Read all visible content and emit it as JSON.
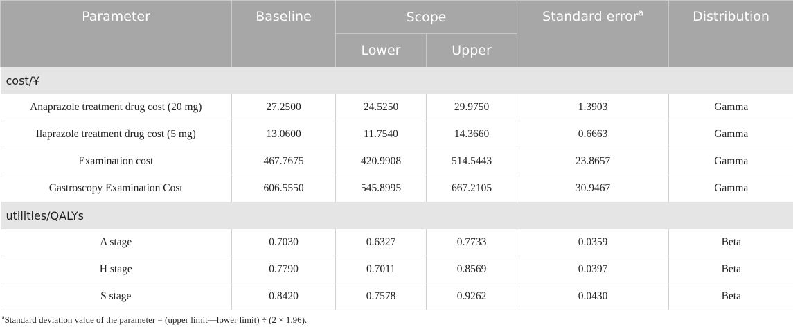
{
  "header": {
    "parameter": "Parameter",
    "baseline": "Baseline",
    "scope": "Scope",
    "lower": "Lower",
    "upper": "Upper",
    "standard_error": "Standard error",
    "standard_error_note": "a",
    "distribution": "Distribution"
  },
  "sections": [
    {
      "title": "cost/¥",
      "rows": [
        [
          "Anaprazole treatment drug cost (20 mg)",
          "27.2500",
          "24.5250",
          "29.9750",
          "1.3903",
          "Gamma"
        ],
        [
          "Ilaprazole treatment drug cost (5 mg)",
          "13.0600",
          "11.7540",
          "14.3660",
          "0.6663",
          "Gamma"
        ],
        [
          "Examination cost",
          "467.7675",
          "420.9908",
          "514.5443",
          "23.8657",
          "Gamma"
        ],
        [
          "Gastroscopy Examination Cost",
          "606.5550",
          "545.8995",
          "667.2105",
          "30.9467",
          "Gamma"
        ]
      ]
    },
    {
      "title": "utilities/QALYs",
      "rows": [
        [
          "A stage",
          "0.7030",
          "0.6327",
          "0.7733",
          "0.0359",
          "Beta"
        ],
        [
          "H stage",
          "0.7790",
          "0.7011",
          "0.8569",
          "0.0397",
          "Beta"
        ],
        [
          "S stage",
          "0.8420",
          "0.7578",
          "0.9262",
          "0.0430",
          "Beta"
        ]
      ]
    }
  ],
  "footnote": {
    "marker": "a",
    "text": "Standard deviation value of the parameter = (upper limit—lower limit) ÷ (2 × 1.96)."
  }
}
